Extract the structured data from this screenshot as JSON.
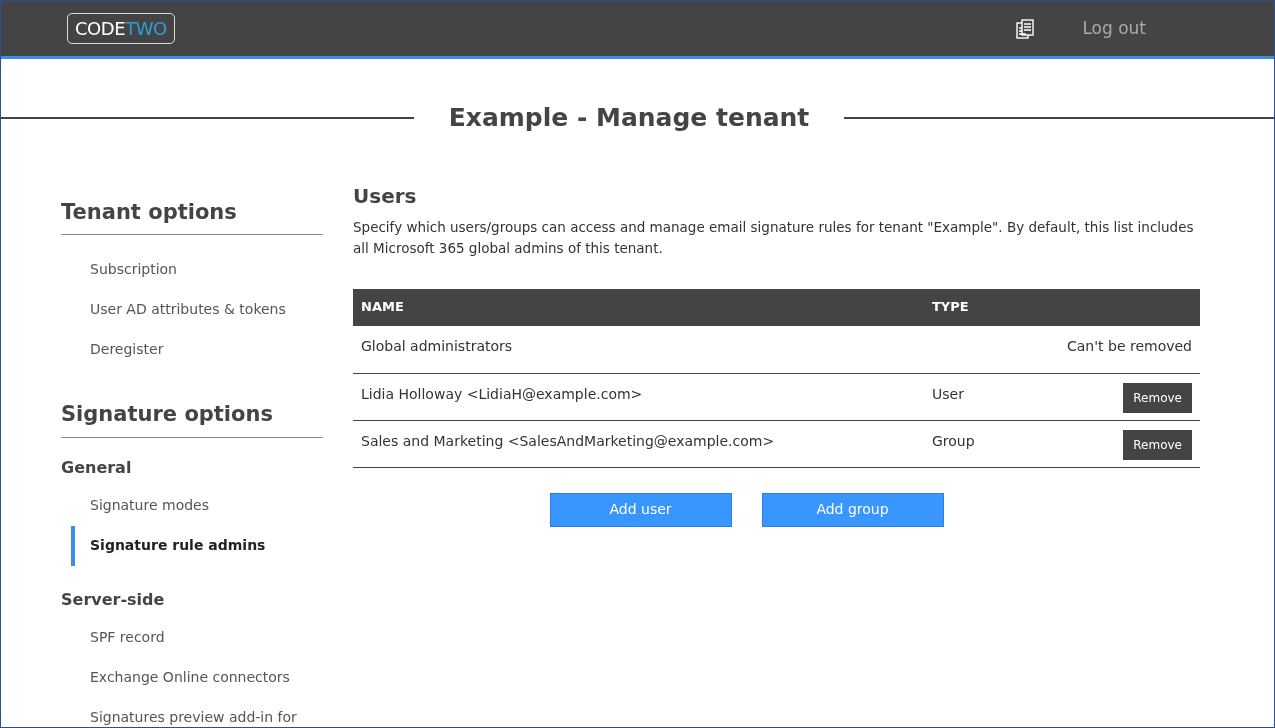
{
  "header": {
    "logo": [
      "CODE",
      "TWO"
    ],
    "logout": "Log out"
  },
  "page_title": "Example - Manage tenant",
  "sidebar": {
    "sections": [
      {
        "title": "Tenant options",
        "groups": [
          {
            "items": [
              {
                "label": "Subscription",
                "selected": false
              },
              {
                "label": "User AD attributes & tokens",
                "selected": false
              },
              {
                "label": "Deregister",
                "selected": false
              }
            ]
          }
        ]
      },
      {
        "title": "Signature options",
        "groups": [
          {
            "heading": "General",
            "items": [
              {
                "label": "Signature modes",
                "selected": false
              },
              {
                "label": "Signature rule admins",
                "selected": true
              }
            ]
          },
          {
            "heading": "Server-side",
            "items": [
              {
                "label": "SPF record",
                "selected": false
              },
              {
                "label": "Exchange Online connectors",
                "selected": false
              },
              {
                "label": "Signatures preview add-in for",
                "selected": false
              }
            ]
          }
        ]
      }
    ]
  },
  "content": {
    "title": "Users",
    "description": "Specify which users/groups can access and manage email signature rules for tenant \"Example\". By default, this list includes all Microsoft 365 global admins of this tenant.",
    "table": {
      "columns": [
        "NAME",
        "TYPE"
      ],
      "rows": [
        {
          "kind": "fixed",
          "name": "Global administrators",
          "note": "Can't be removed"
        },
        {
          "kind": "removable",
          "name": "Lidia Holloway <LidiaH@example.com>",
          "type": "User",
          "action": "Remove"
        },
        {
          "kind": "removable",
          "name": "Sales and Marketing <SalesAndMarketing@example.com>",
          "type": "Group",
          "action": "Remove"
        }
      ]
    },
    "buttons": [
      "Add user",
      "Add group"
    ]
  }
}
